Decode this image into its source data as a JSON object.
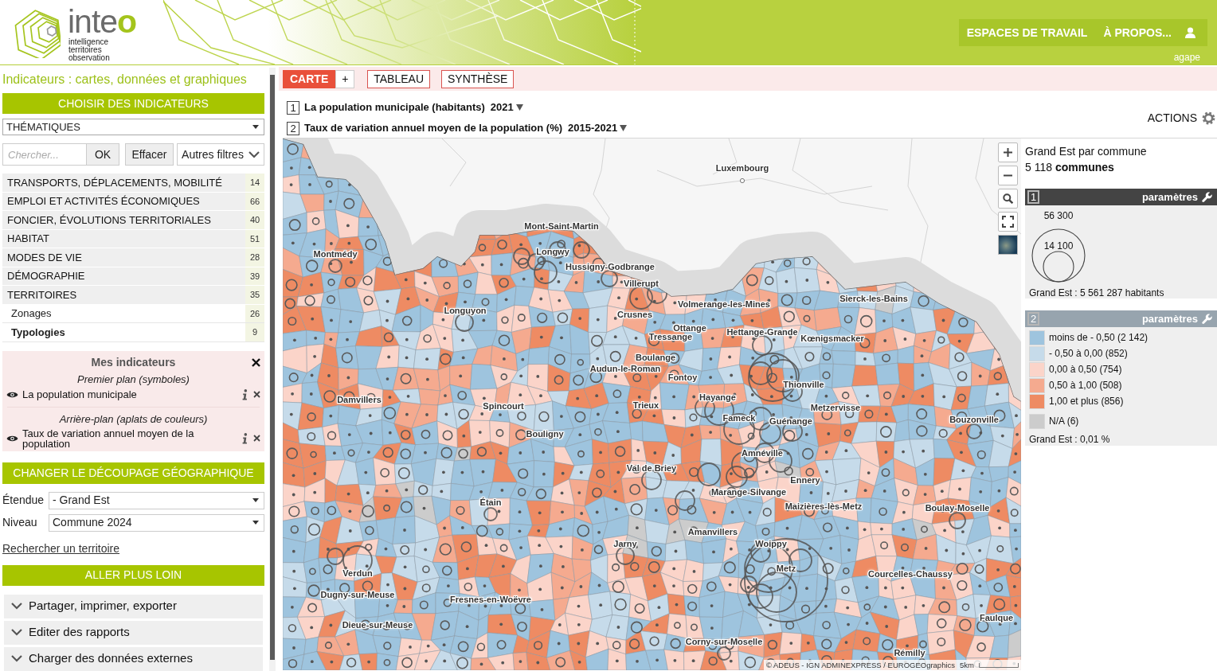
{
  "header": {
    "logo": {
      "name": "inte",
      "accent": "o",
      "tagline": [
        "intelligence",
        "territoires",
        "observation"
      ]
    },
    "nav": [
      "ESPACES DE TRAVAIL",
      "À PROPOS..."
    ],
    "user": "agape"
  },
  "sidebar": {
    "title": "Indicateurs : cartes, données et graphiques",
    "choose_button": "CHOISIR DES INDICATEURS",
    "theme_select": "THÉMATIQUES",
    "search": {
      "placeholder": "Chercher...",
      "ok": "OK",
      "clear": "Effacer",
      "filters": "Autres filtres"
    },
    "themes": [
      {
        "label": "TRANSPORTS, DÉPLACEMENTS, MOBILITÉ",
        "count": "14"
      },
      {
        "label": "EMPLOI ET ACTIVITÉS ÉCONOMIQUES",
        "count": "66"
      },
      {
        "label": "FONCIER, ÉVOLUTIONS TERRITORIALES",
        "count": "40"
      },
      {
        "label": "HABITAT",
        "count": "51"
      },
      {
        "label": "MODES DE VIE",
        "count": "28"
      },
      {
        "label": "DÉMOGRAPHIE",
        "count": "39"
      },
      {
        "label": "TERRITOIRES",
        "count": "35",
        "children": [
          {
            "label": "Zonages",
            "count": "26",
            "selected": false
          },
          {
            "label": "Typologies",
            "count": "9",
            "selected": true
          }
        ]
      }
    ],
    "my_indicators": {
      "title": "Mes indicateurs",
      "layers": [
        {
          "plan": "Premier plan (symboles)",
          "label": "La population municipale",
          "visible": true
        },
        {
          "plan": "Arrière-plan (aplats de couleurs)",
          "label": "Taux de variation annuel moyen de la population",
          "visible": true
        }
      ]
    },
    "geo_button": "CHANGER LE DÉCOUPAGE GÉOGRAPHIQUE",
    "fields": [
      {
        "label": "Étendue",
        "value": "- Grand Est"
      },
      {
        "label": "Niveau",
        "value": "Commune 2024"
      }
    ],
    "territory_link": "Rechercher un territoire",
    "more_button": "ALLER PLUS LOIN",
    "sections": [
      {
        "label": "Partager, imprimer, exporter",
        "expanded": false
      },
      {
        "label": "Editer des rapports",
        "expanded": false
      },
      {
        "label": "Charger des données externes",
        "expanded": false
      }
    ]
  },
  "view_tabs": {
    "tabs": [
      {
        "label": "CARTE",
        "selected": true
      },
      {
        "label": "TABLEAU",
        "selected": false
      },
      {
        "label": "SYNTHÈSE",
        "selected": false
      }
    ],
    "add": "+"
  },
  "indicators": [
    {
      "number": "1",
      "label": "La population municipale (habitants)",
      "period": "2021"
    },
    {
      "number": "2",
      "label": "Taux de variation annuel moyen de la population (%)",
      "period": "2015-2021"
    }
  ],
  "actions": "ACTIONS",
  "map": {
    "places": [
      "Luxembourg",
      "Mont-Saint-Martin",
      "Montmédy",
      "Longwy",
      "Hussigny-Godbrange",
      "Villerupt",
      "Longuyon",
      "Volmerange-les-Mines",
      "Crusnes",
      "Sierck-les-Bains",
      "Ottange",
      "Hettange-Grande",
      "Tressange",
      "Kœnigsmacker",
      "Boulange",
      "Audun-le-Roman",
      "Fontoy",
      "Thionville",
      "Hayange",
      "Damvillers",
      "Spincourt",
      "Trieux",
      "Metzervisse",
      "Fameck",
      "Guénange",
      "Bouzonville",
      "Bouligny",
      "Amnéville",
      "Val de Briey",
      "Ennery",
      "Marange-Silvange",
      "Étain",
      "Maizières-lès-Metz",
      "Boulay-Moselle",
      "Amanvillers",
      "Jarny",
      "Woippy",
      "Verdun",
      "Metz",
      "Courcelles-Chaussy",
      "Dugny-sur-Meuse",
      "Fresnes-en-Woëvre",
      "Faulque",
      "Dieue-sur-Meuse",
      "Corny-sur-Moselle",
      "Rémilly"
    ],
    "attribution": "© ADEUS - IGN ADMINEXPRESS / EUROGEOgraphics",
    "scale": "5km"
  },
  "legend": {
    "title": "Grand Est par commune",
    "count": "5 118 **communes**",
    "layers": [
      {
        "number": "1",
        "kind": "symbols",
        "selected": true,
        "settings": "paramètres",
        "sizes": [
          "56 300",
          "14 100"
        ],
        "total": "Grand Est : 5 561 287 habitants"
      },
      {
        "number": "2",
        "kind": "classes",
        "selected": false,
        "settings": "paramètres",
        "classes": [
          {
            "label": "moins de - 0,50 (2 142)",
            "color": "#9ec4de",
            "kind": "class"
          },
          {
            "label": "- 0,50 à 0,00 (852)",
            "color": "#c6dbea",
            "kind": "class"
          },
          {
            "label": "0,00 à 0,50 (754)",
            "color": "#fbd4c9",
            "kind": "class"
          },
          {
            "label": "0,50 à 1,00 (508)",
            "color": "#f5aa8f",
            "kind": "class"
          },
          {
            "label": "1,00 et plus (856)",
            "color": "#ee8b63",
            "kind": "class"
          },
          {
            "label": "N/A (6)",
            "color": "#cccccc",
            "kind": "missing"
          }
        ],
        "total": "Grand Est : 0,01 %"
      }
    ]
  }
}
